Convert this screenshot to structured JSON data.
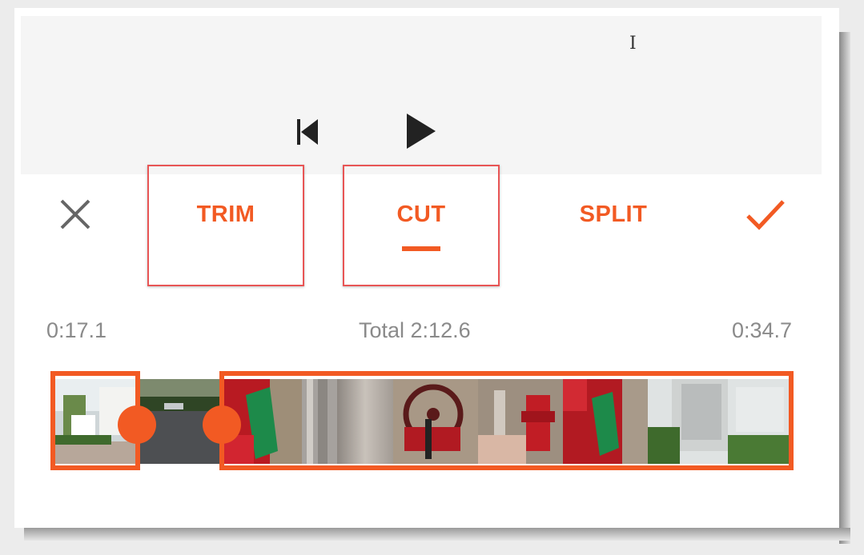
{
  "colors": {
    "accent": "#f25a23",
    "highlight_box": "#e85555",
    "time_text": "#8a8a8a",
    "icon_gray": "#666666"
  },
  "player": {
    "skip_start_icon": "skip-to-start-icon",
    "play_icon": "play-icon"
  },
  "toolbar": {
    "close_icon": "close-icon",
    "confirm_icon": "checkmark-icon",
    "tabs": [
      {
        "label": "TRIM"
      },
      {
        "label": "CUT",
        "selected": true
      },
      {
        "label": "SPLIT"
      }
    ]
  },
  "times": {
    "start": "0:17.1",
    "total": "Total 2:12.6",
    "end": "0:34.7"
  },
  "timeline": {
    "frames": [
      "building-sign-frame",
      "parking-lot-frame",
      "red-hydrant-tag-frame",
      "metal-panel-frame",
      "brushed-metal-frame",
      "red-valve-wheel-frame",
      "red-hydrant-frame",
      "red-hydrant-tag-frame-2",
      "white-building-frame"
    ]
  }
}
